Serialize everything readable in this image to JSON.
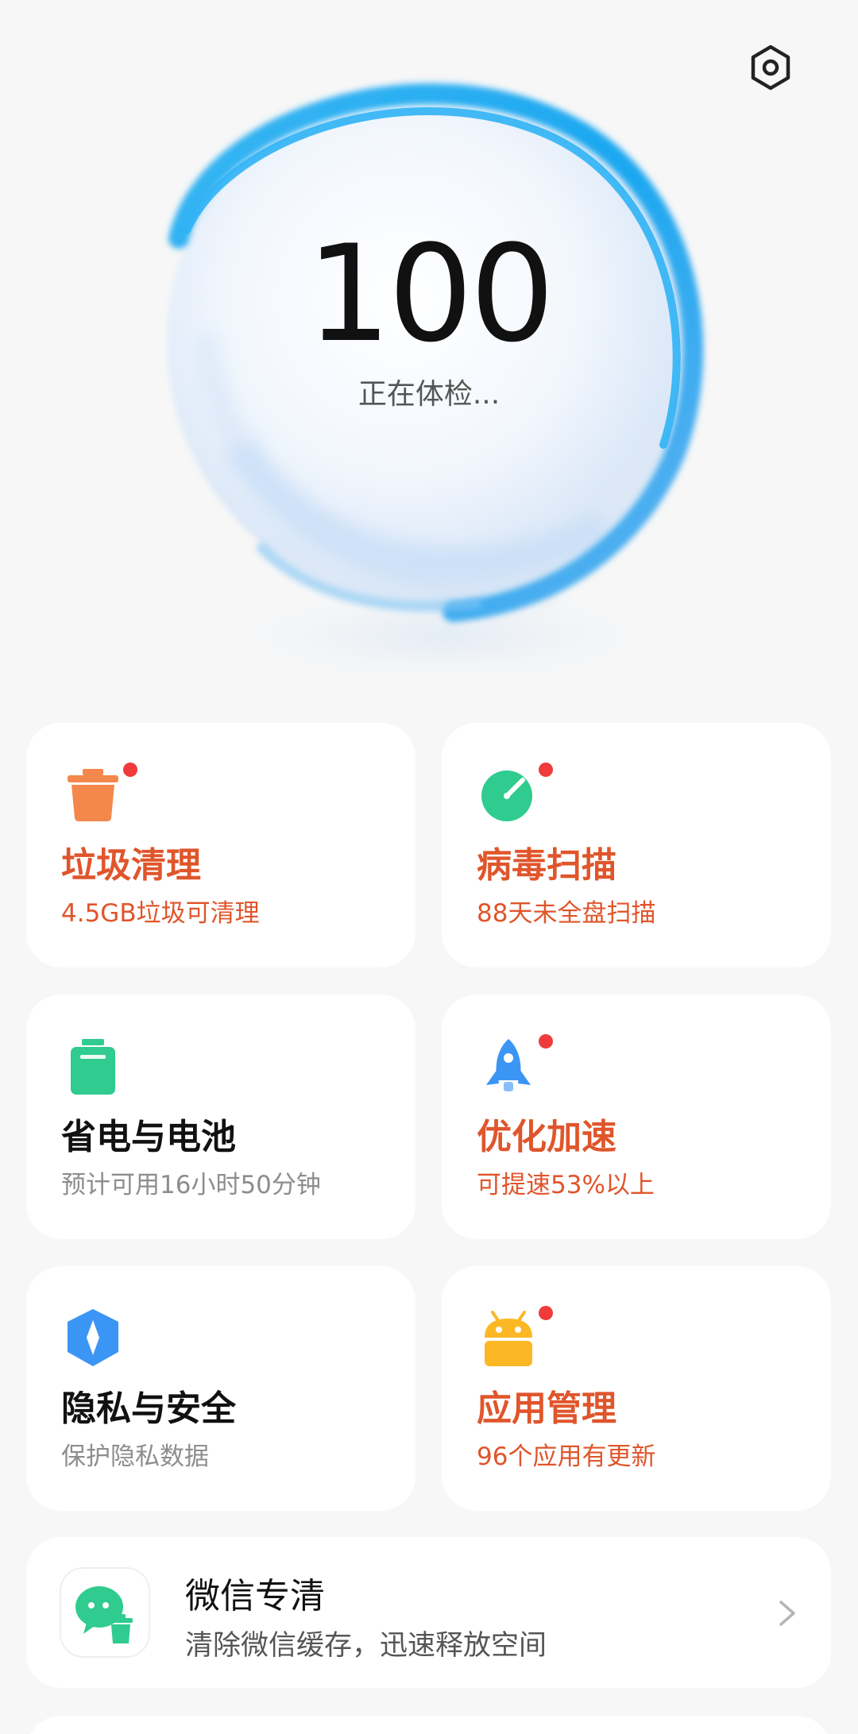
{
  "hero": {
    "score": "100",
    "status": "正在体检..."
  },
  "icons": {
    "settings": "gear-hexagon-icon",
    "trash": "trash-can-icon",
    "virus": "virus-scan-icon",
    "battery": "battery-icon",
    "boost": "rocket-icon",
    "privacy": "shield-icon",
    "apps": "android-icon",
    "wechat": "wechat-clean-icon",
    "chevron": "chevron-right-icon"
  },
  "colors": {
    "warning_text": "#e0552b",
    "badge_dot": "#ef3b3b",
    "orb_ring": "#1aa7f0"
  },
  "cards": [
    {
      "title": "垃圾清理",
      "subtitle": "4.5GB垃圾可清理",
      "badge": true,
      "icon_color": "#f4874b"
    },
    {
      "title": "病毒扫描",
      "subtitle": "88天未全盘扫描",
      "badge": true,
      "icon_color": "#2fcb8f"
    },
    {
      "title": "省电与电池",
      "subtitle": "预计可用16小时50分钟",
      "badge": false,
      "icon_color": "#2fcb8f"
    },
    {
      "title": "优化加速",
      "subtitle": "可提速53%以上",
      "badge": true,
      "icon_color": "#3b95f5"
    },
    {
      "title": "隐私与安全",
      "subtitle": "保护隐私数据",
      "badge": false,
      "icon_color": "#3b95f5"
    },
    {
      "title": "应用管理",
      "subtitle": "96个应用有更新",
      "badge": true,
      "icon_color": "#fbb824"
    }
  ],
  "wechat": {
    "title": "微信专清",
    "subtitle": "清除微信缓存，迅速释放空间",
    "icon_color": "#2fcb8f"
  }
}
